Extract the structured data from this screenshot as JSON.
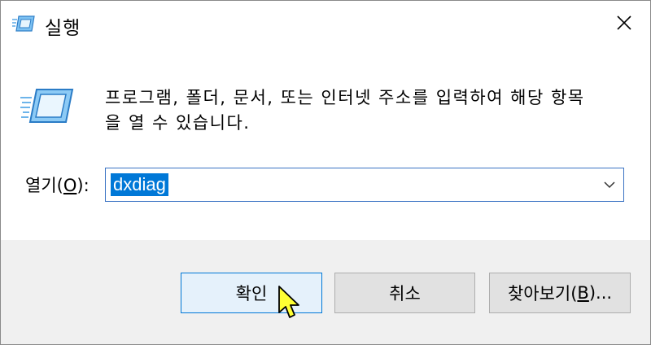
{
  "window": {
    "title": "실행"
  },
  "content": {
    "description_line1": "프로그램, 폴더, 문서, 또는 인터넷 주소를 입력하여 해당 항목",
    "description_line2": "을 열 수 있습니다.",
    "open_label_prefix": "열기(",
    "open_label_mnemonic": "O",
    "open_label_suffix": "):",
    "open_value": "dxdiag"
  },
  "buttons": {
    "ok_label": "확인",
    "cancel_label": "취소",
    "browse_prefix": "찾아보기(",
    "browse_mnemonic": "B",
    "browse_suffix": ")..."
  },
  "colors": {
    "selection": "#0078d7",
    "footer_bg": "#f0f0f0",
    "ok_button_bg": "#e5f1fb",
    "cursor_fill": "#ffff33"
  },
  "icons": {
    "title": "run-icon",
    "close": "close-icon",
    "dropdown": "chevron-down-icon",
    "pointer": "mouse-cursor-icon"
  }
}
